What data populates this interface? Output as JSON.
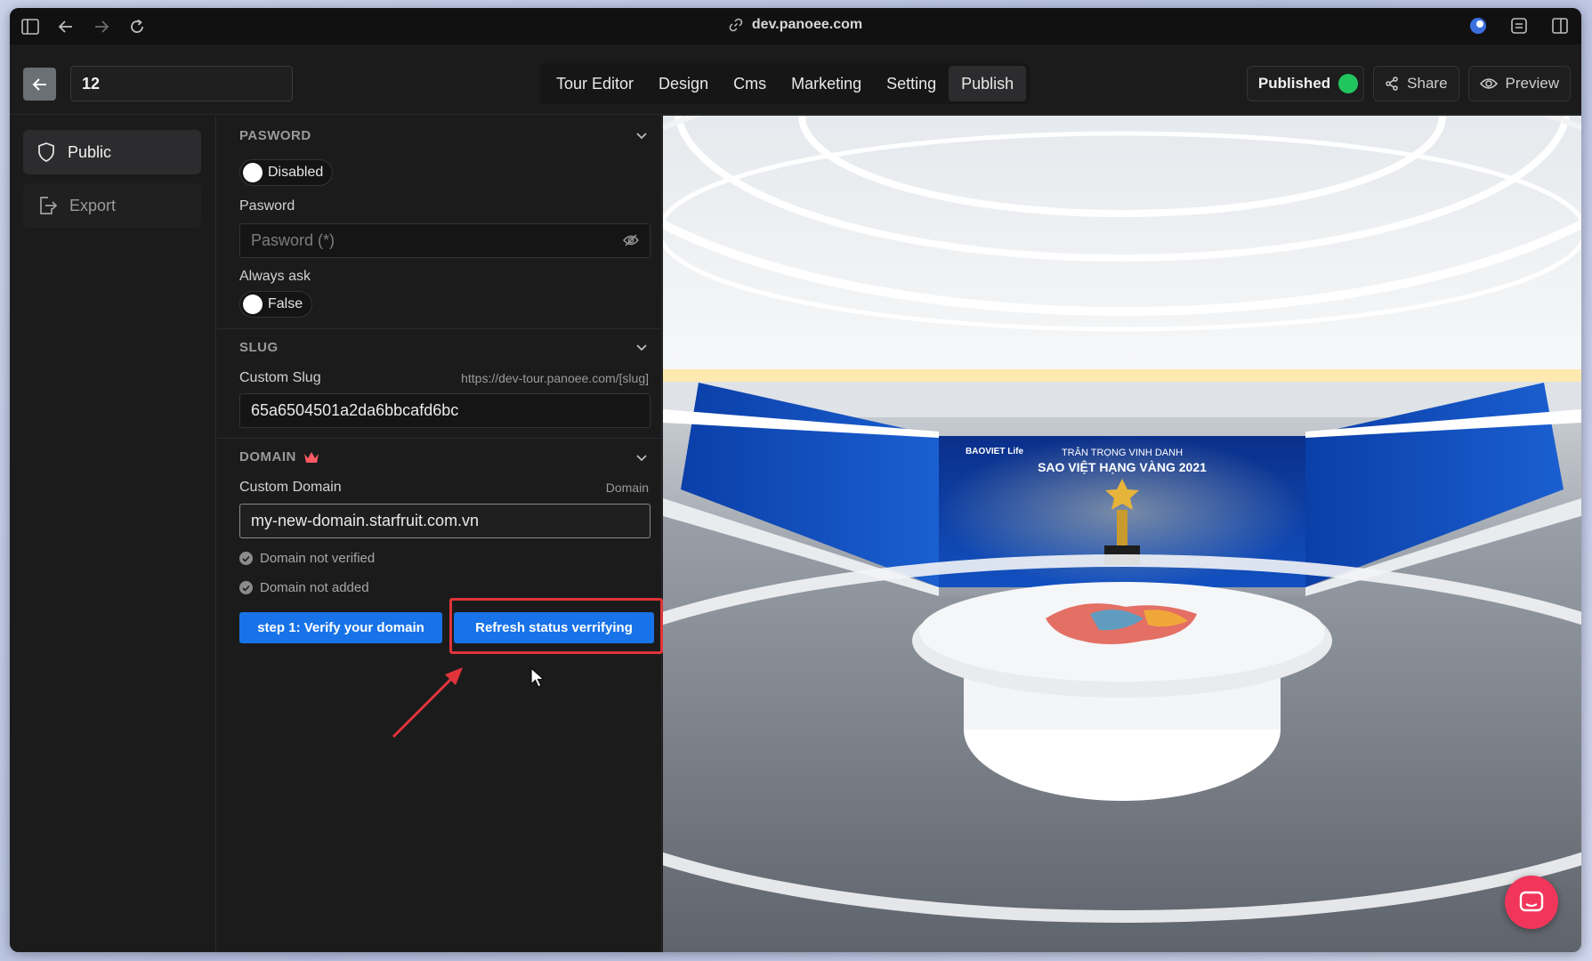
{
  "browser": {
    "url": "dev.panoee.com"
  },
  "app": {
    "tour_name": "12",
    "tabs": [
      {
        "label": "Tour Editor",
        "active": false
      },
      {
        "label": "Design",
        "active": false
      },
      {
        "label": "Cms",
        "active": false
      },
      {
        "label": "Marketing",
        "active": false
      },
      {
        "label": "Setting",
        "active": false
      },
      {
        "label": "Publish",
        "active": true
      }
    ],
    "published_label": "Published",
    "share_label": "Share",
    "preview_label": "Preview"
  },
  "sidebar": {
    "items": [
      {
        "label": "Public",
        "icon": "shield-icon",
        "active": true
      },
      {
        "label": "Export",
        "icon": "export-icon",
        "active": false
      }
    ]
  },
  "password_section": {
    "title": "PASWORD",
    "toggle_label": "Disabled",
    "password_label": "Pasword",
    "password_placeholder": "Pasword (*)",
    "always_ask_label": "Always ask",
    "always_ask_value": "False"
  },
  "slug_section": {
    "title": "SLUG",
    "custom_slug_label": "Custom Slug",
    "slug_hint": "https://dev-tour.panoee.com/[slug]",
    "slug_value": "65a6504501a2da6bbcafd6bc"
  },
  "domain_section": {
    "title": "DOMAIN",
    "custom_domain_label": "Custom Domain",
    "domain_hint": "Domain",
    "domain_value": "my-new-domain.starfruit.com.vn",
    "status_1": "Domain not verified",
    "status_2": "Domain not added",
    "verify_button": "step 1: Verify your domain",
    "refresh_button": "Refresh status verrifying"
  },
  "viewer": {
    "banner_brand": "BAOVIET Life",
    "banner_line1": "TRÂN TRỌNG VINH DANH",
    "banner_line2": "SAO VIỆT HẠNG VÀNG 2021"
  },
  "colors": {
    "accent": "#1873e8",
    "highlight": "#e0343a",
    "published": "#21c55d",
    "chat": "#f2355b"
  }
}
